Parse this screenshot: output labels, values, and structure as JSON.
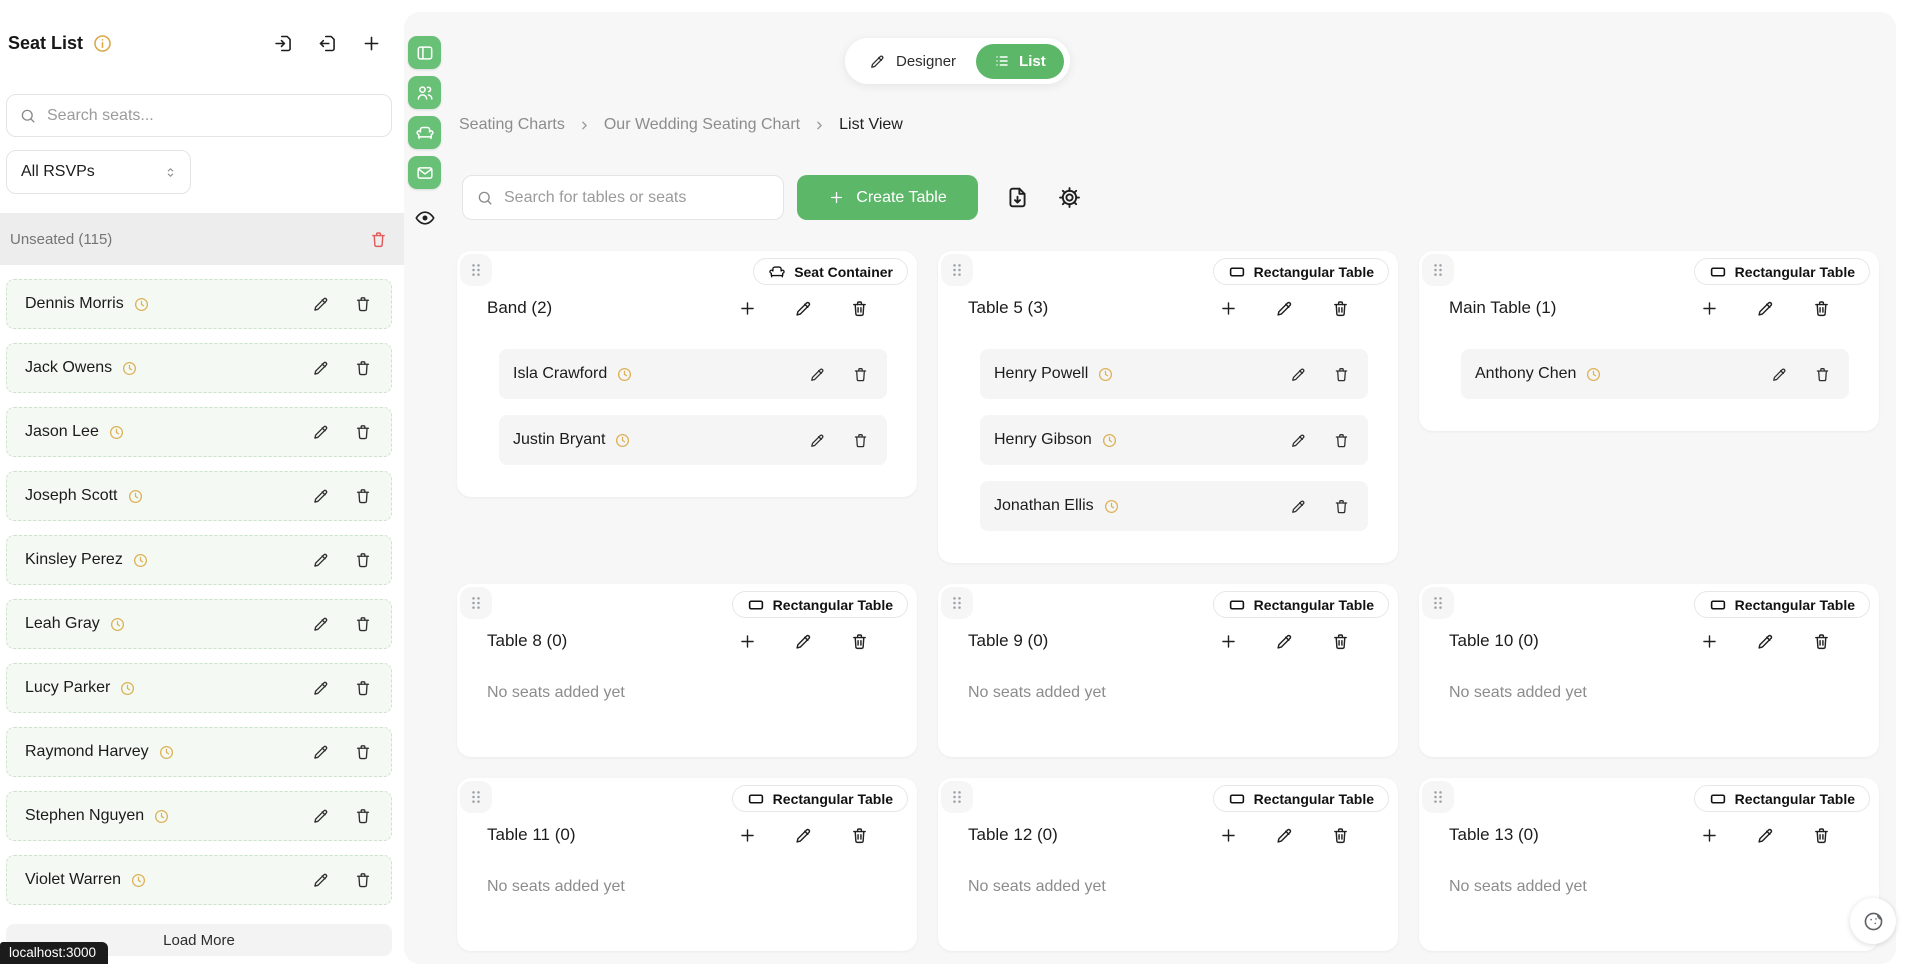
{
  "colors": {
    "accent_green": "#5cb768",
    "toolbar_green": "#69c177",
    "clock_amber": "#dcb157",
    "danger_red": "#e05b5b"
  },
  "sidebar": {
    "title": "Seat List",
    "search_placeholder": "Search seats...",
    "rsvp_filter_value": "All RSVPs",
    "unseated_header": "Unseated (115)",
    "guests": [
      "Dennis Morris",
      "Jack Owens",
      "Jason Lee",
      "Joseph Scott",
      "Kinsley Perez",
      "Leah Gray",
      "Lucy Parker",
      "Raymond Harvey",
      "Stephen Nguyen",
      "Violet Warren"
    ],
    "load_more_label": "Load More"
  },
  "view_toggle": {
    "designer_label": "Designer",
    "list_label": "List"
  },
  "breadcrumb": {
    "items": [
      "Seating Charts",
      "Our Wedding Seating Chart",
      "List View"
    ]
  },
  "content_toolbar": {
    "search_placeholder": "Search for tables or seats",
    "create_table_label": "Create Table"
  },
  "tables": [
    {
      "name": "Band (2)",
      "type_badge": "Seat Container",
      "badge_icon": "sofa-icon",
      "guests": [
        "Isla Crawford",
        "Justin Bryant"
      ],
      "empty_text": ""
    },
    {
      "name": "Table 5 (3)",
      "type_badge": "Rectangular Table",
      "badge_icon": "rectangle-icon",
      "guests": [
        "Henry Powell",
        "Henry Gibson",
        "Jonathan Ellis"
      ],
      "empty_text": ""
    },
    {
      "name": "Main Table (1)",
      "type_badge": "Rectangular Table",
      "badge_icon": "rectangle-icon",
      "guests": [
        "Anthony Chen"
      ],
      "empty_text": ""
    },
    {
      "name": "Table 8 (0)",
      "type_badge": "Rectangular Table",
      "badge_icon": "rectangle-icon",
      "guests": [],
      "empty_text": "No seats added yet"
    },
    {
      "name": "Table 9 (0)",
      "type_badge": "Rectangular Table",
      "badge_icon": "rectangle-icon",
      "guests": [],
      "empty_text": "No seats added yet"
    },
    {
      "name": "Table 10 (0)",
      "type_badge": "Rectangular Table",
      "badge_icon": "rectangle-icon",
      "guests": [],
      "empty_text": "No seats added yet"
    },
    {
      "name": "Table 11 (0)",
      "type_badge": "Rectangular Table",
      "badge_icon": "rectangle-icon",
      "guests": [],
      "empty_text": "No seats added yet"
    },
    {
      "name": "Table 12 (0)",
      "type_badge": "Rectangular Table",
      "badge_icon": "rectangle-icon",
      "guests": [],
      "empty_text": "No seats added yet"
    },
    {
      "name": "Table 13 (0)",
      "type_badge": "Rectangular Table",
      "badge_icon": "rectangle-icon",
      "guests": [],
      "empty_text": "No seats added yet"
    }
  ],
  "status_bar": {
    "url": "localhost:3000"
  }
}
